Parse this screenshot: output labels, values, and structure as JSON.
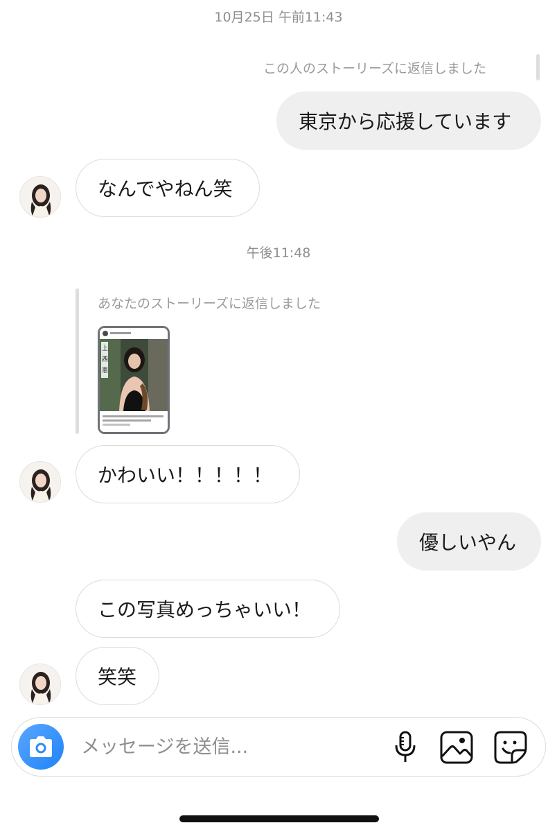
{
  "thread": {
    "timestamp_1": "10月25日 午前11:43",
    "timestamp_2": "午後11:48"
  },
  "messages": {
    "m1_reply_note": "この人のストーリーズに返信しました",
    "m1_text": "東京から応援しています",
    "m2_text": "なんでやねん笑",
    "m3_reply_note": "あなたのストーリーズに返信しました",
    "m4_text": "かわいい！！！！！",
    "m5_text": "優しいやん",
    "m6_text": "この写真めっちゃいい！",
    "m7_text": "笑笑"
  },
  "story_preview": {
    "title_chars": "上西恵"
  },
  "composer": {
    "placeholder": "メッセージを送信..."
  },
  "colors": {
    "camera_button": "#3797f0",
    "bubble_outgoing": "#efefef",
    "bubble_incoming_border": "#dbdbdb"
  },
  "icons": {
    "camera": "camera-icon",
    "mic": "microphone-icon",
    "gallery": "image-icon",
    "sticker": "sticker-icon"
  }
}
